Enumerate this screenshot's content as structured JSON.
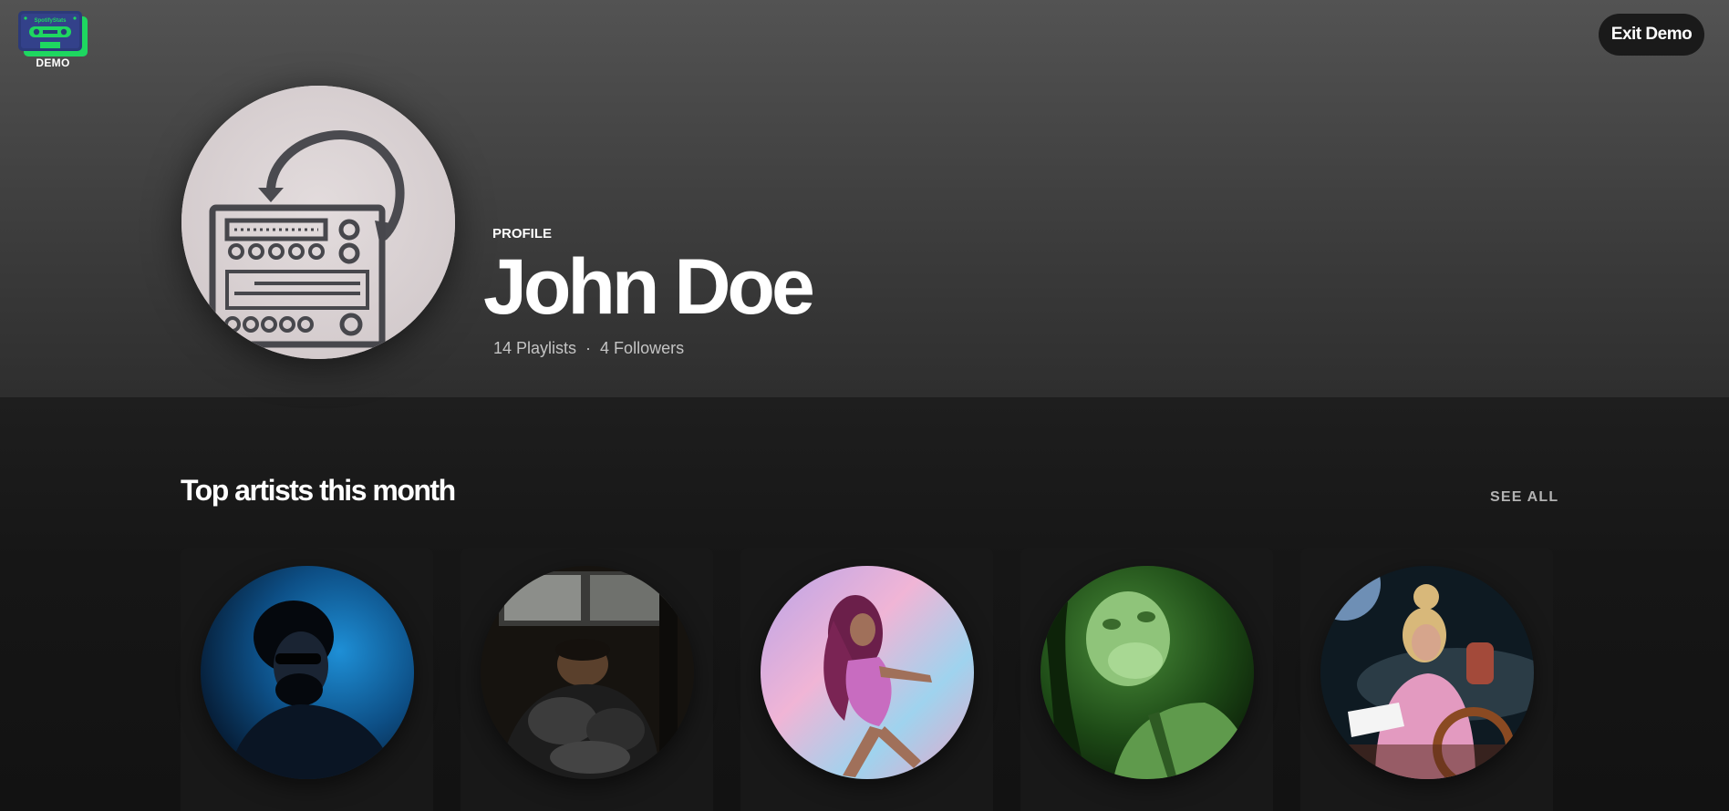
{
  "app": {
    "logo_text": "DEMO",
    "logo_inner_text": "SpotifyStats",
    "accent_color": "#1ed760"
  },
  "header": {
    "exit_button_label": "Exit Demo"
  },
  "profile": {
    "label": "PROFILE",
    "name": "John Doe",
    "playlists": "14 Playlists",
    "separator": "·",
    "followers": "4 Followers"
  },
  "top_artists": {
    "title": "Top artists this month",
    "see_all_label": "SEE ALL",
    "artists": [
      {
        "image": "blue-toned-portrait-with-sunglasses"
      },
      {
        "image": "portrait-in-car-with-puffer-jacket"
      },
      {
        "image": "pastel-portrait-in-pink-outfit"
      },
      {
        "image": "green-toned-portrait"
      },
      {
        "image": "portrait-in-pink-jacket-at-steering-wheel"
      }
    ]
  }
}
